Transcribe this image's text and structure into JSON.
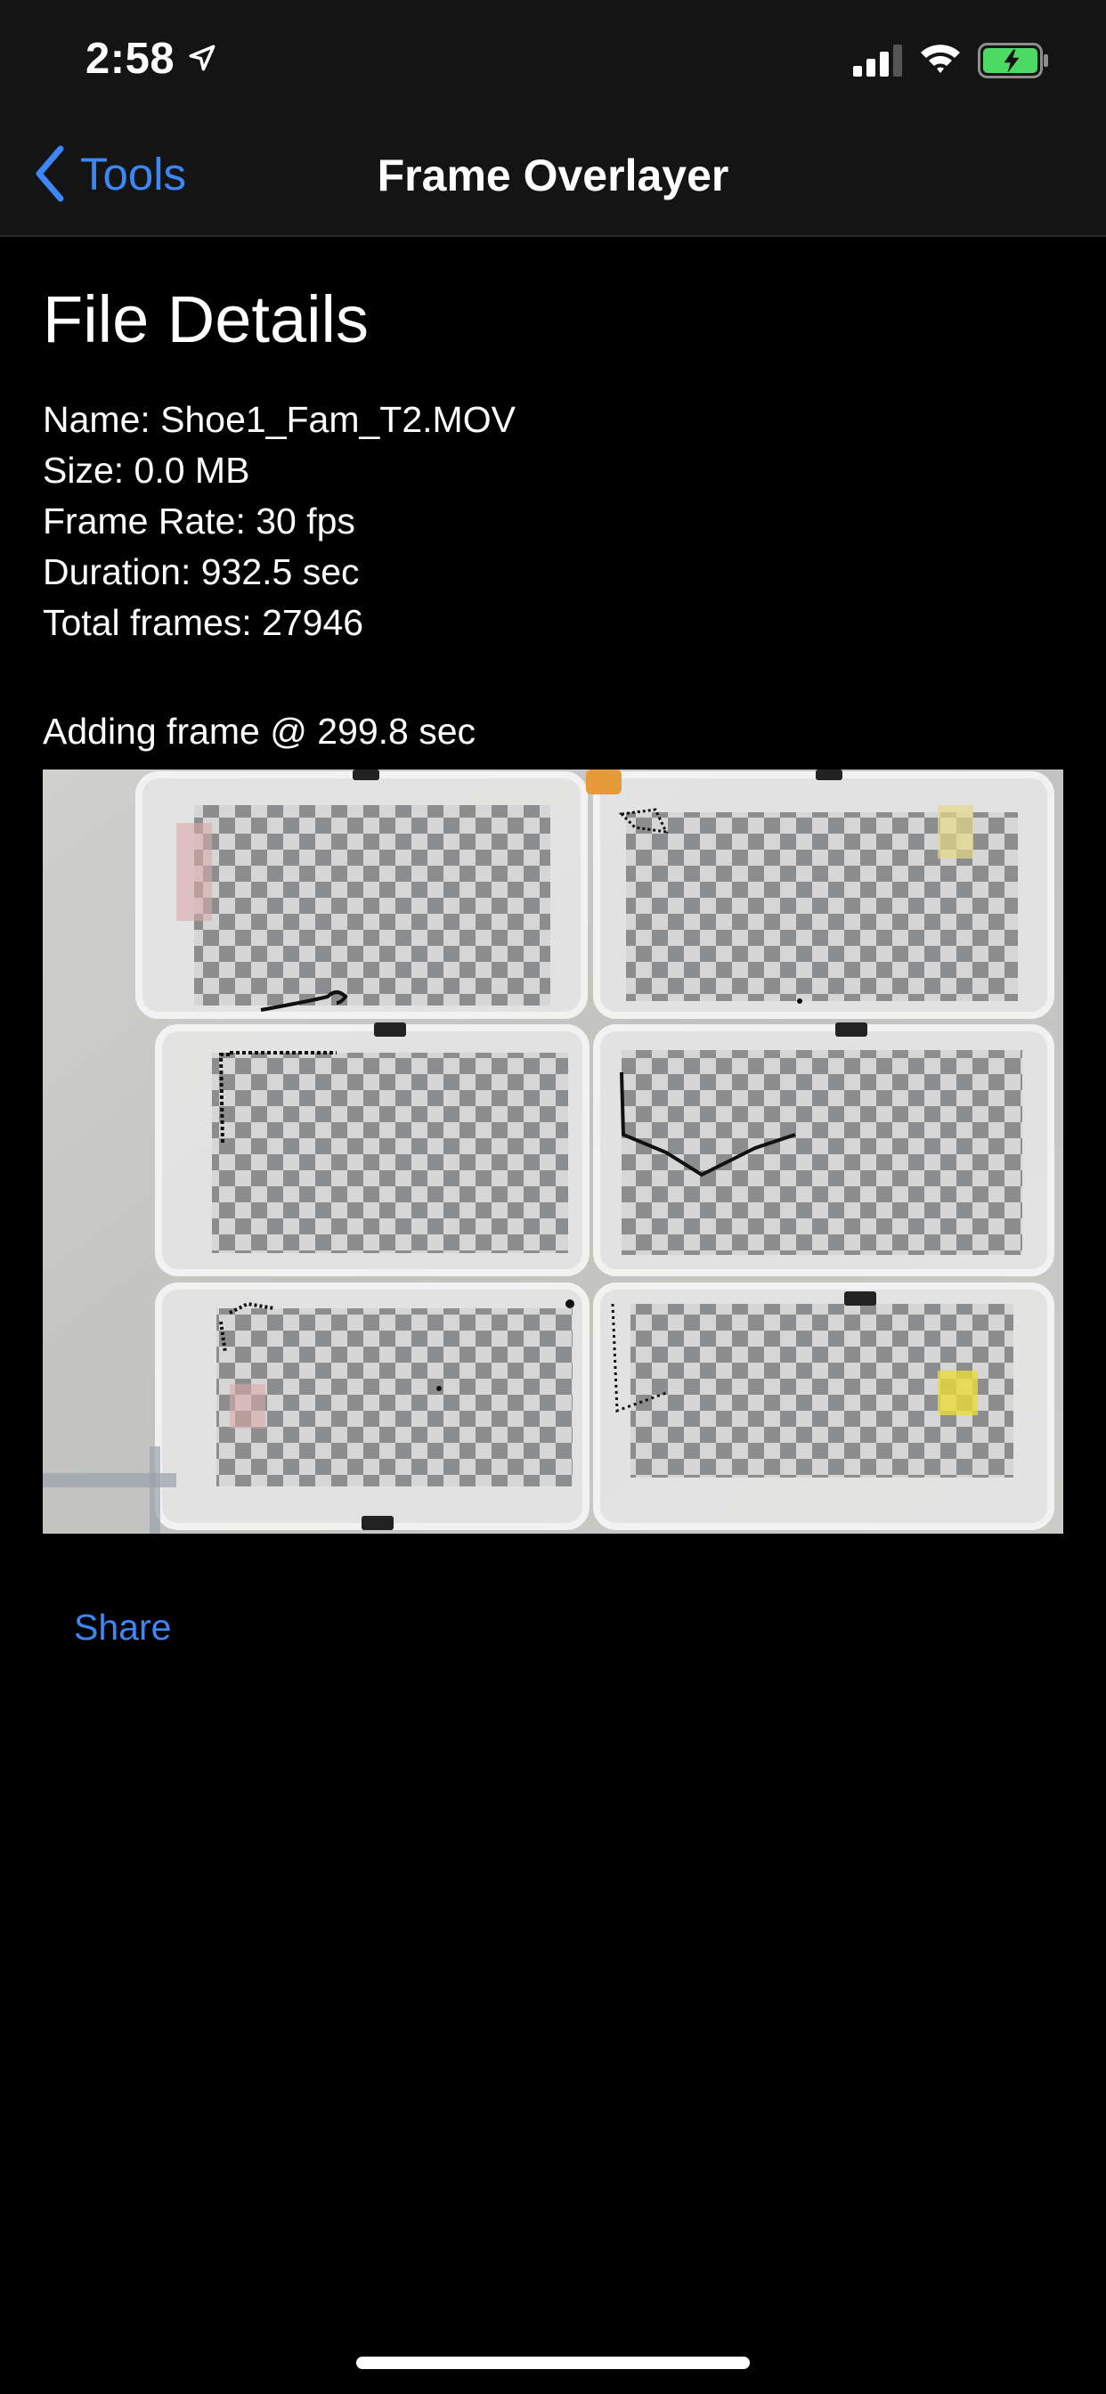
{
  "status_bar": {
    "time": "2:58",
    "location_icon": "location-arrow-icon",
    "signal_icon": "cellular-signal-icon",
    "wifi_icon": "wifi-icon",
    "battery_icon": "battery-charging-icon",
    "battery_color": "#4cd964"
  },
  "nav": {
    "back_label": "Tools",
    "title": "Frame Overlayer",
    "accent": "#3d86f5"
  },
  "file_details": {
    "heading": "File Details",
    "name": "Name: Shoe1_Fam_T2.MOV",
    "size": "Size: 0.0 MB",
    "frame_rate": "Frame Rate: 30 fps",
    "duration": "Duration: 932.5 sec",
    "total_frames": "Total frames: 27946"
  },
  "overlay": {
    "status": "Adding frame @ 299.8 sec"
  },
  "actions": {
    "share_label": "Share"
  }
}
